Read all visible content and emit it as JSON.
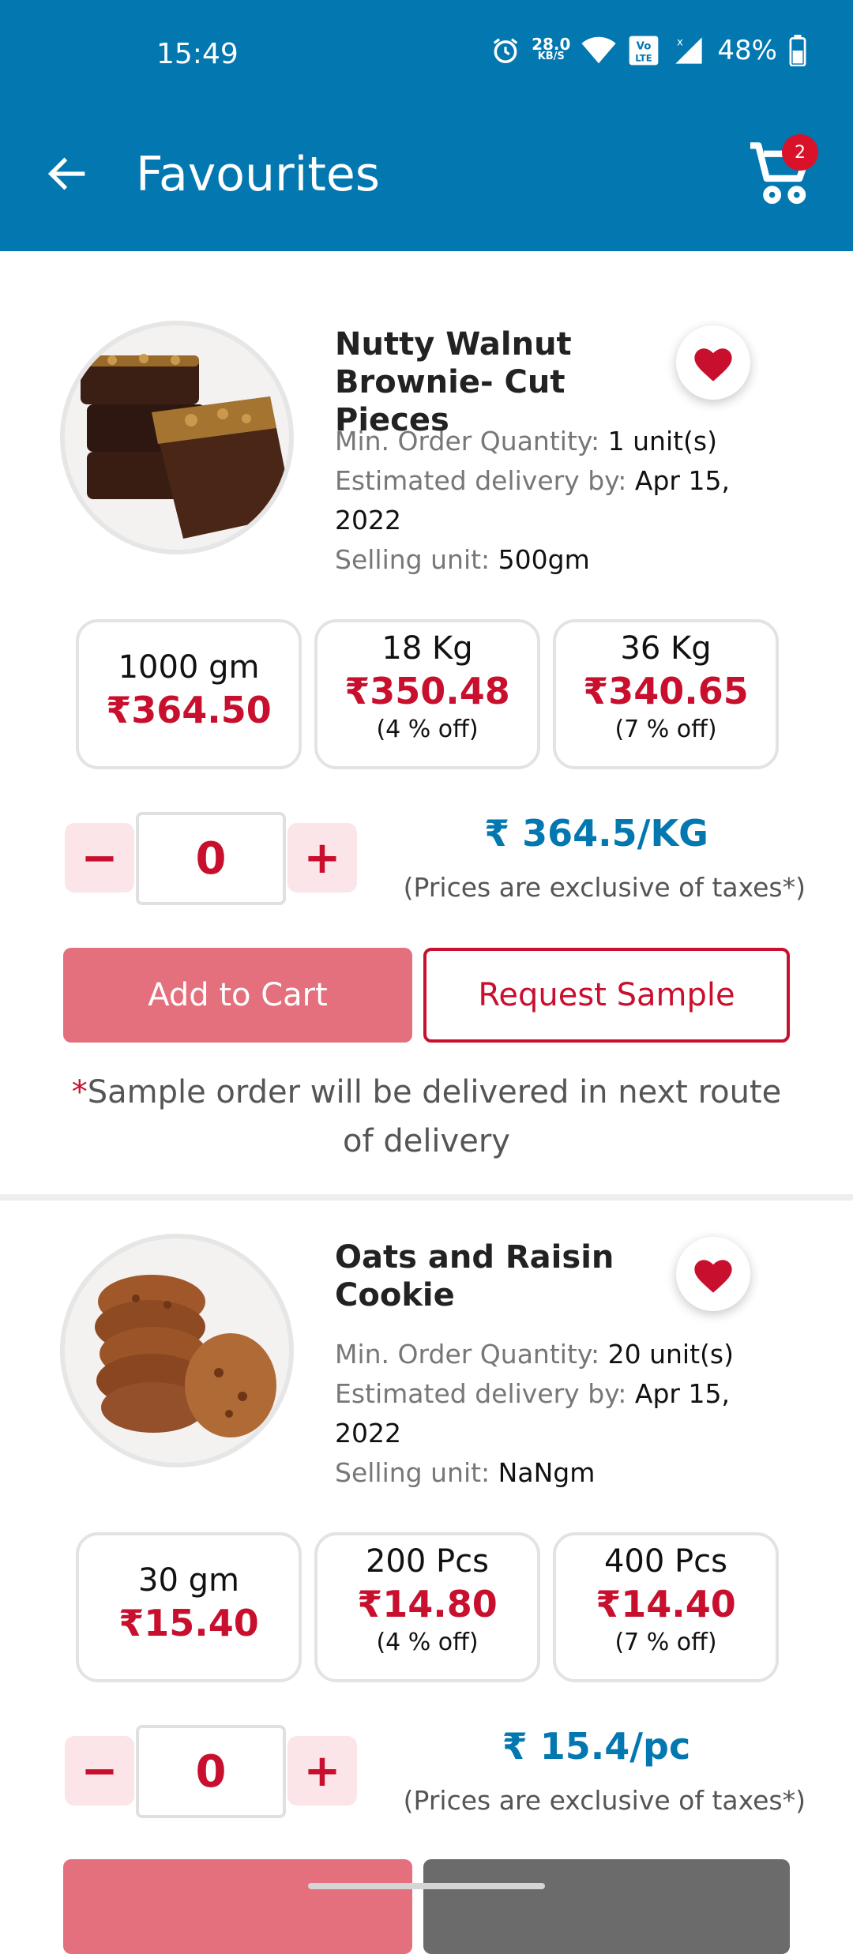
{
  "status_bar": {
    "time": "15:49",
    "net_speed_value": "28.0",
    "net_speed_unit": "KB/S",
    "battery": "48%",
    "icons": [
      "alarm-icon",
      "wifi-icon",
      "volte-icon",
      "signal-icon",
      "battery-icon"
    ]
  },
  "header": {
    "title": "Favourites",
    "cart_count": "2"
  },
  "products": [
    {
      "name": "Nutty Walnut Brownie- Cut Pieces",
      "min_order_label": "Min. Order Quantity:",
      "min_order_value": "1 unit(s)",
      "delivery_label": "Estimated delivery by:",
      "delivery_value": "Apr 15, 2022",
      "selling_unit_label": "Selling unit:",
      "selling_unit_value": "500gm",
      "tiers": [
        {
          "qty": "1000 gm",
          "price": "₹364.50",
          "off": ""
        },
        {
          "qty": "18 Kg",
          "price": "₹350.48",
          "off": "(4 % off)"
        },
        {
          "qty": "36 Kg",
          "price": "₹340.65",
          "off": "(7 % off)"
        }
      ],
      "quantity": "0",
      "unit_price": "₹ 364.5/KG",
      "tax_note": "(Prices are exclusive of taxes*)",
      "add_to_cart": "Add to Cart",
      "request_sample": "Request Sample",
      "sample_note": "Sample order will be delivered in next route of delivery"
    },
    {
      "name": "Oats and Raisin Cookie",
      "min_order_label": "Min. Order Quantity:",
      "min_order_value": "20 unit(s)",
      "delivery_label": "Estimated delivery by:",
      "delivery_value": "Apr 15, 2022",
      "selling_unit_label": "Selling unit:",
      "selling_unit_value": "NaNgm",
      "tiers": [
        {
          "qty": "30 gm",
          "price": "₹15.40",
          "off": ""
        },
        {
          "qty": "200 Pcs",
          "price": "₹14.80",
          "off": "(4 % off)"
        },
        {
          "qty": "400 Pcs",
          "price": "₹14.40",
          "off": "(7 % off)"
        }
      ],
      "quantity": "0",
      "unit_price": "₹ 15.4/pc",
      "tax_note": "(Prices are exclusive of taxes*)"
    }
  ],
  "colors": {
    "primary": "#0277b0",
    "accent_red": "#c8102e",
    "add_to_cart_bg": "#e5707d"
  }
}
